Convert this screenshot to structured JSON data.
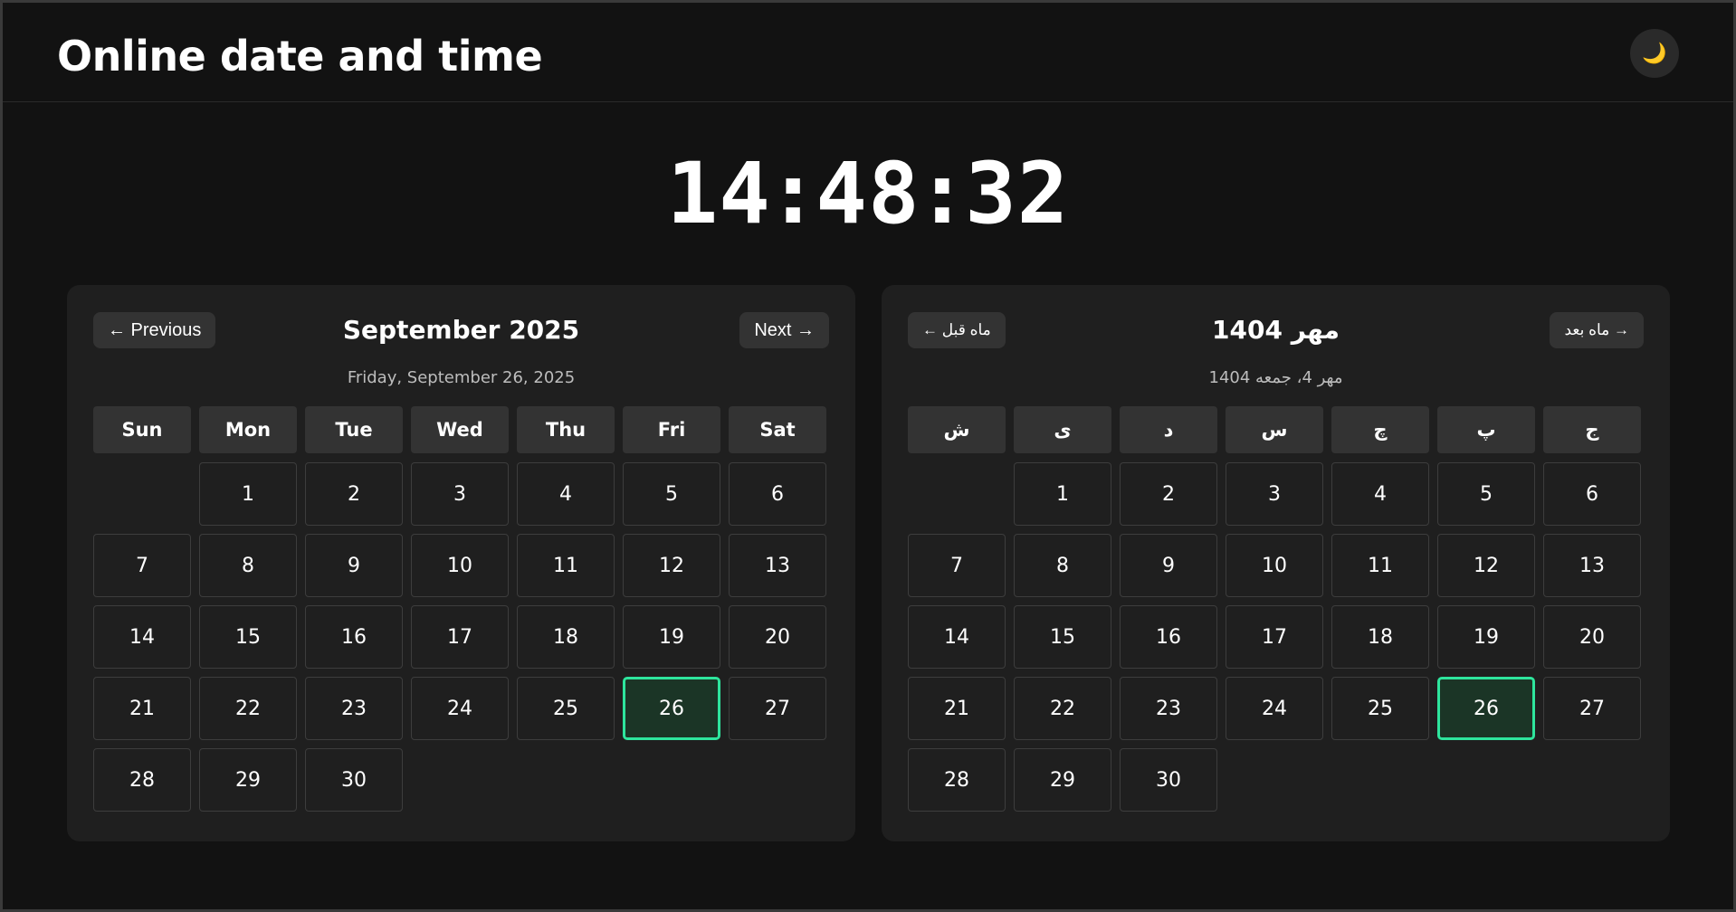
{
  "header": {
    "title": "Online date and time",
    "theme_icon": "crescent-moon-icon",
    "theme_glyph": "🌙"
  },
  "clock": {
    "hours": "14",
    "minutes": "48",
    "seconds": "32",
    "separator": ":"
  },
  "gregorian": {
    "prev_label": "← Previous",
    "next_label": "Next →",
    "month_title": "September 2025",
    "full_date": "Friday, September 26, 2025",
    "weekdays": [
      "Sun",
      "Mon",
      "Tue",
      "Wed",
      "Thu",
      "Fri",
      "Sat"
    ],
    "leading_blanks": 1,
    "days_in_month": 30,
    "today": 26
  },
  "persian": {
    "prev_label": "← ماه قبل",
    "next_label": "ماه بعد →",
    "month_title": "مهر 1404",
    "full_date": "مهر 4، جمعه 1404",
    "weekdays": [
      "ش",
      "ی",
      "د",
      "س",
      "چ",
      "پ",
      "ج"
    ],
    "leading_blanks": 1,
    "days_in_month": 30,
    "today": 26
  },
  "colors": {
    "background": "#121212",
    "card": "#1f1f1f",
    "button": "#333333",
    "today_border": "#2ee59d",
    "today_fill": "#1b3526"
  }
}
